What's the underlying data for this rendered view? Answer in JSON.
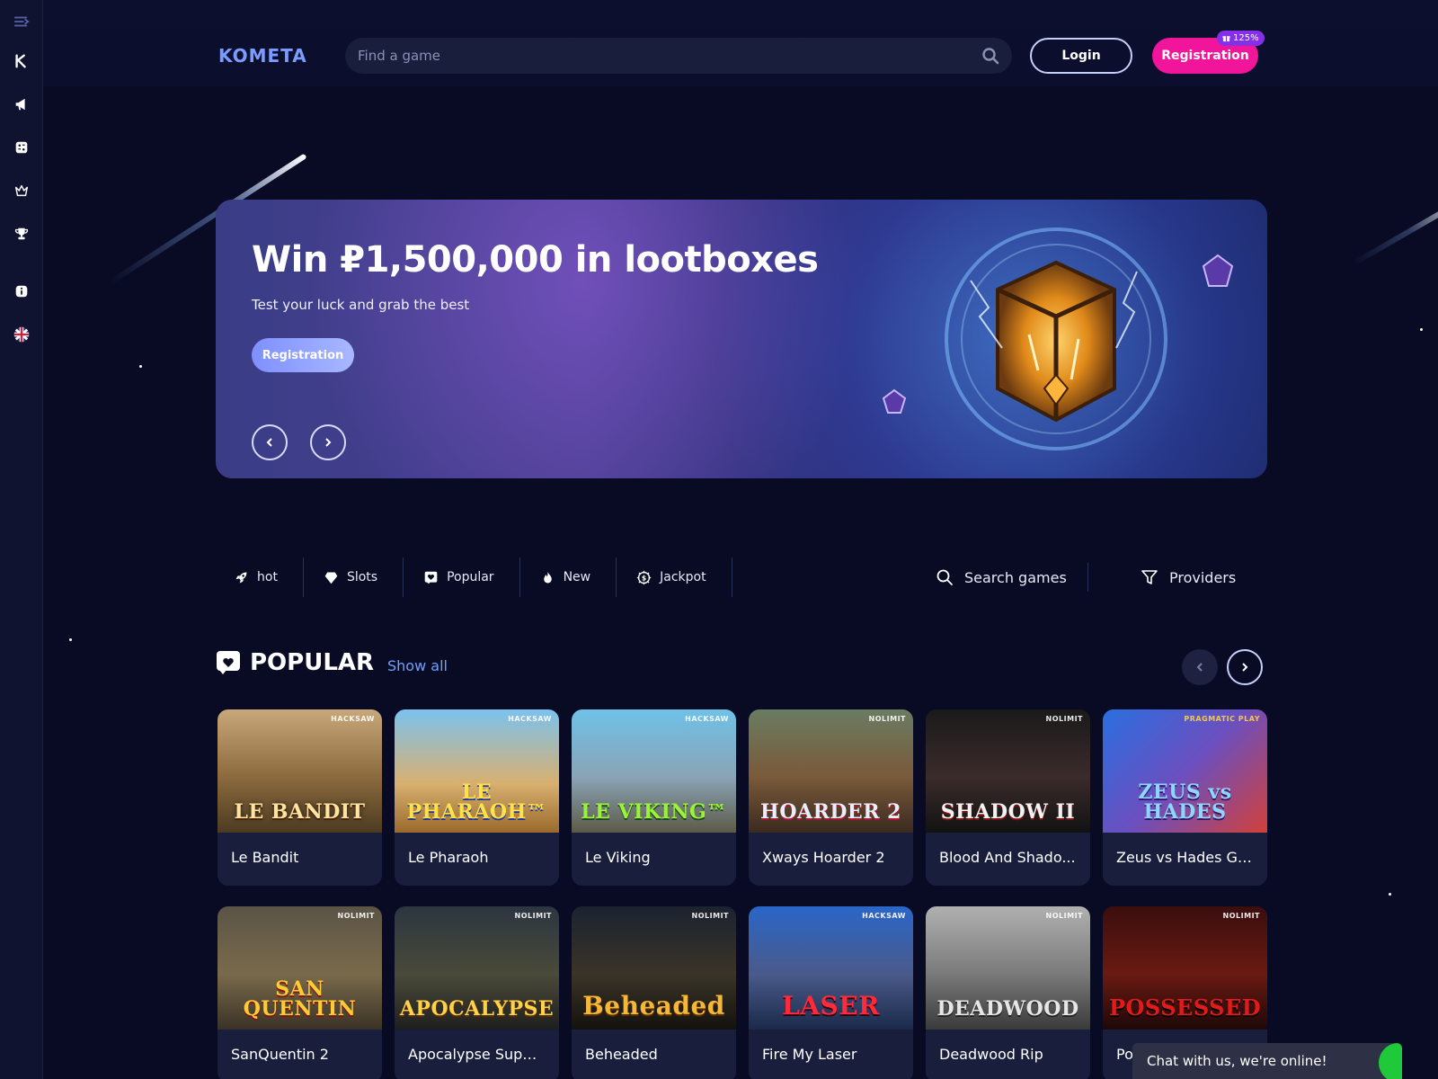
{
  "brand": {
    "logo_text": "KOMETA"
  },
  "header": {
    "search_placeholder": "Find a game",
    "login_label": "Login",
    "registration_label": "Registration",
    "bonus_badge": "125%"
  },
  "sidebar": {
    "items": [
      {
        "icon": "menu-icon"
      },
      {
        "icon": "kometa-logo-icon"
      },
      {
        "icon": "megaphone-icon"
      },
      {
        "icon": "dice-icon"
      },
      {
        "icon": "crown-icon"
      },
      {
        "icon": "trophy-icon"
      },
      {
        "icon": "info-icon"
      },
      {
        "icon": "uk-flag-icon"
      }
    ]
  },
  "banner": {
    "title": "Win ₽1,500,000 in lootboxes",
    "subtitle": "Test your luck and grab the best",
    "cta_label": "Registration"
  },
  "tabs": {
    "items": [
      {
        "label": "hot",
        "icon": "rocket-icon"
      },
      {
        "label": "Slots",
        "icon": "diamond-icon"
      },
      {
        "label": "Popular",
        "icon": "heart-icon"
      },
      {
        "label": "New",
        "icon": "flame-icon"
      },
      {
        "label": "Jackpot",
        "icon": "jackpot-icon"
      }
    ],
    "search_label": "Search games",
    "providers_label": "Providers"
  },
  "section": {
    "title": "POPULAR",
    "show_all_label": "Show all"
  },
  "games": [
    {
      "name": "Le Bandit",
      "art_text": "LE BANDIT",
      "provider": "HACKSAW"
    },
    {
      "name": "Le Pharaoh",
      "art_text": "LE PHARAOH™",
      "provider": "HACKSAW"
    },
    {
      "name": "Le Viking",
      "art_text": "LE VIKING™",
      "provider": "HACKSAW"
    },
    {
      "name": "Xways Hoarder 2",
      "art_text": "HOARDER 2",
      "provider": "NOLIMIT"
    },
    {
      "name": "Blood And Shado...",
      "art_text": "SHADOW II",
      "provider": "NOLIMIT"
    },
    {
      "name": "Zeus vs Hades Go...",
      "art_text": "ZEUS vs HADES",
      "provider": "PRAGMATIC PLAY"
    },
    {
      "name": "SanQuentin 2",
      "art_text": "SAN QUENTIN",
      "provider": "NOLIMIT"
    },
    {
      "name": "Apocalypse Super...",
      "art_text": "APOCALYPSE",
      "provider": "NOLIMIT"
    },
    {
      "name": "Beheaded",
      "art_text": "Beheaded",
      "provider": "NOLIMIT"
    },
    {
      "name": "Fire My Laser",
      "art_text": "LASER",
      "provider": "HACKSAW"
    },
    {
      "name": "Deadwood Rip",
      "art_text": "DEADWOOD",
      "provider": "NOLIMIT"
    },
    {
      "name": "Po",
      "art_text": "POSSESSED",
      "provider": "NOLIMIT"
    }
  ],
  "chat": {
    "label": "Chat with us, we're online!"
  },
  "colors": {
    "background": "#090b24",
    "sidebar": "#0f1330",
    "accent_pink": "#f0159a",
    "link_blue": "#6ea0ff",
    "badge_purple": "#8330e6"
  }
}
